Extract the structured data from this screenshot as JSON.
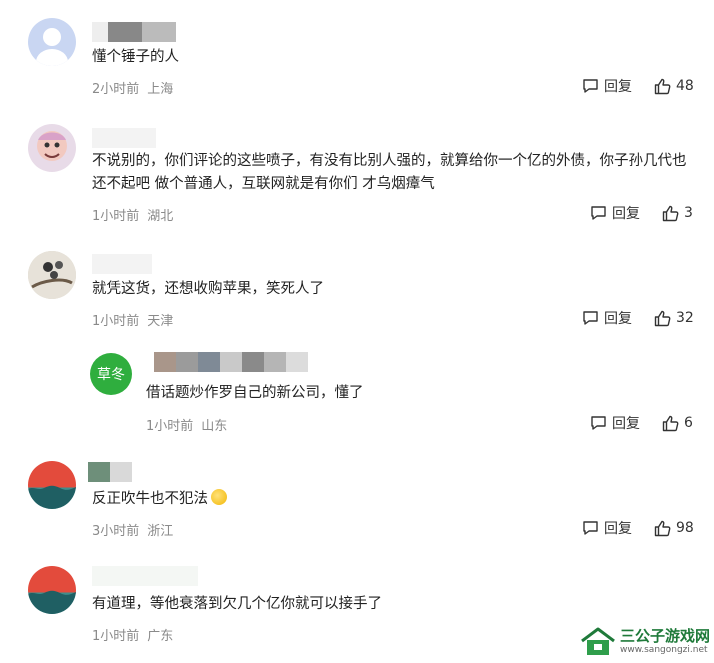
{
  "comments": [
    {
      "text": "懂个锤子的人",
      "time": "2小时前",
      "location": "上海",
      "reply_label": "回复",
      "likes": "48"
    },
    {
      "text": "不说别的，你们评论的这些喷子，有没有比别人强的，就算给你一个亿的外债，你子孙几代也还不起吧 做个普通人，互联网就是有你们 才乌烟瘴气",
      "time": "1小时前",
      "location": "湖北",
      "reply_label": "回复",
      "likes": "3"
    },
    {
      "text": "就凭这货，还想收购苹果，笑死人了",
      "time": "1小时前",
      "location": "天津",
      "reply_label": "回复",
      "likes": "32"
    },
    {
      "text": "借话题炒作罗自己的新公司，懂了",
      "time": "1小时前",
      "location": "山东",
      "reply_label": "回复",
      "likes": "6",
      "avatar_text": "草冬"
    },
    {
      "text": "反正吹牛也不犯法",
      "time": "3小时前",
      "location": "浙江",
      "reply_label": "回复",
      "likes": "98"
    },
    {
      "text": "有道理，等他衰落到欠几个亿你就可以接手了",
      "time": "1小时前",
      "location": "广东"
    }
  ],
  "watermark": {
    "title": "三公子游戏网",
    "url": "www.sangongzi.net"
  },
  "icons": {
    "reply": "comment-bubble-icon",
    "like": "thumbs-up-icon"
  }
}
